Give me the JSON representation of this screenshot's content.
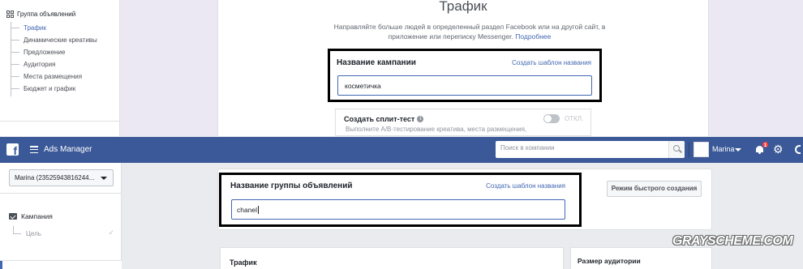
{
  "top_panel": {
    "sidebar": {
      "group_title": "Группа объявлений",
      "items": [
        {
          "label": "Трафик"
        },
        {
          "label": "Динамические креативы"
        },
        {
          "label": "Предложение"
        },
        {
          "label": "Аудитория"
        },
        {
          "label": "Места размещения"
        },
        {
          "label": "Бюджет и график"
        }
      ]
    },
    "objective": {
      "title": "Трафик",
      "description": "Направляйте больше людей в определенный раздел Facebook или на другой сайт, в приложение или переписку Messenger.",
      "more_link": "Подробнее"
    },
    "campaign_name": {
      "label": "Название кампании",
      "template_link": "Создать шаблон названия",
      "value": "косметичка"
    },
    "split_test": {
      "title": "Создать сплит-тест",
      "description": "Выполните A/B-тестирование креатива, места размещения,",
      "toggle_state": "ОТКЛ."
    }
  },
  "topbar": {
    "app_title": "Ads Manager",
    "search_placeholder": "Поиск в компании",
    "user_name": "Marina",
    "notification_count": "1",
    "icons": [
      "facebook-logo-icon",
      "menu-icon",
      "search-icon",
      "chevron-down-icon",
      "bell-icon",
      "gear-icon"
    ]
  },
  "bottom_panel": {
    "account_selector": "Marina (23525943816244...",
    "tree": {
      "campaign": "Кампания",
      "goal": "Цель"
    },
    "adset_name": {
      "label": "Название группы объявлений",
      "template_link": "Создать шаблон названия",
      "value": "chanel"
    },
    "quick_creation_button": "Режим быстрого создания",
    "traffic_section": "Трафик",
    "audience_section": "Размер аудитории"
  },
  "watermark": "GRAYSCHEME.COM",
  "colors": {
    "brand_blue": "#3b5998",
    "link_blue": "#4267b2",
    "highlight_border": "#000000"
  }
}
